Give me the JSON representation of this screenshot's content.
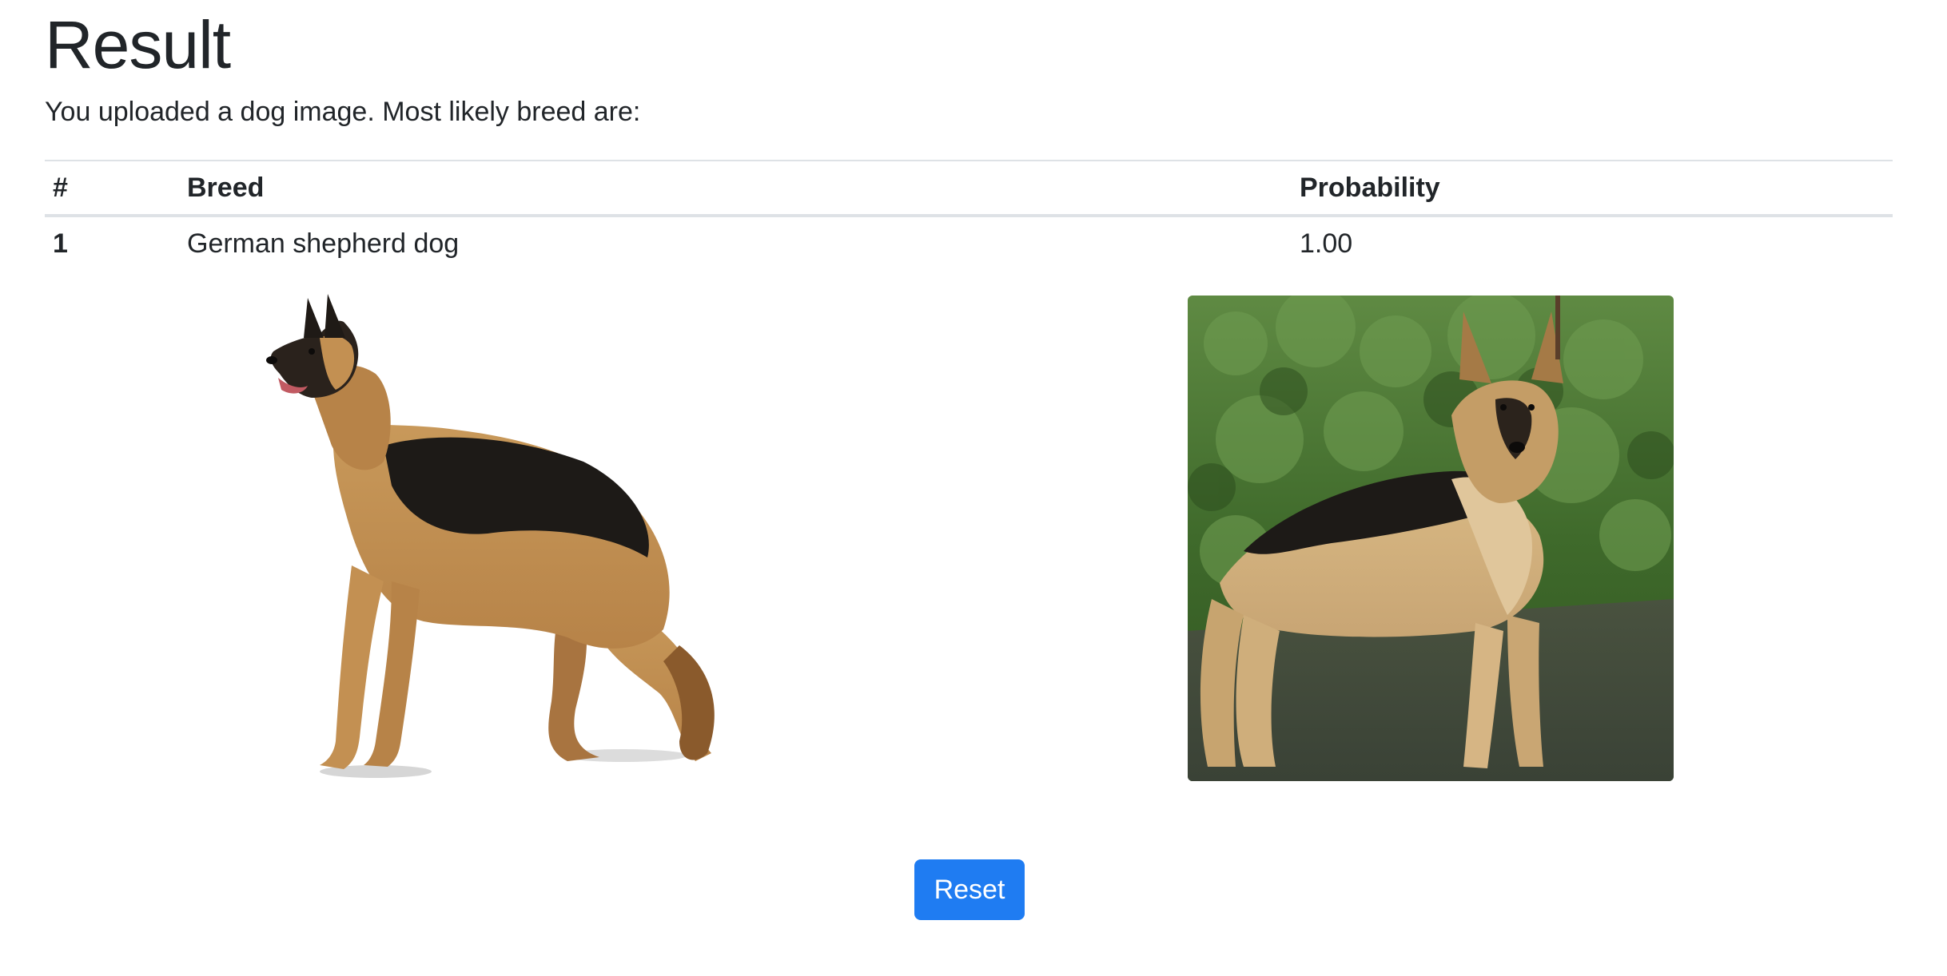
{
  "header": {
    "title": "Result",
    "subtitle": "You uploaded a dog image. Most likely breed are:"
  },
  "table": {
    "columns": [
      "#",
      "Breed",
      "Probability"
    ],
    "rows": [
      {
        "rank": "1",
        "breed": "German shepherd dog",
        "probability": "1.00"
      }
    ]
  },
  "images": {
    "reference": {
      "icon": "german-shepherd-reference-image"
    },
    "uploaded": {
      "icon": "uploaded-dog-photo"
    }
  },
  "actions": {
    "reset_label": "Reset"
  },
  "colors": {
    "accent": "#1f7cf2",
    "text": "#212529",
    "border": "#dee2e6"
  }
}
